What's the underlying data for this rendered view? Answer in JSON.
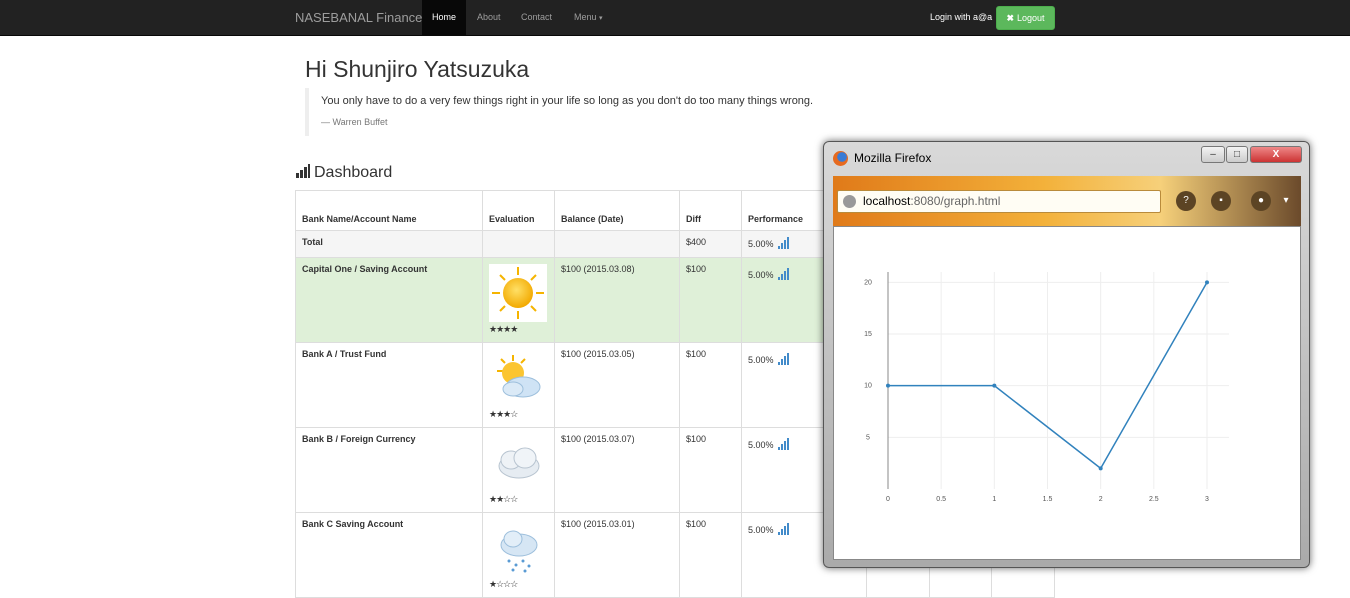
{
  "navbar": {
    "brand": "NASEBANAL Finance",
    "links": [
      {
        "label": "Home",
        "active": true
      },
      {
        "label": "About",
        "active": false
      },
      {
        "label": "Contact",
        "active": false
      },
      {
        "label": "Menu",
        "active": false
      }
    ],
    "menu_caret": "▾",
    "login_text": "Login with a@a",
    "logout_label": "Logout",
    "logout_icon": "✖"
  },
  "greeting": "Hi Shunjiro Yatsuzuka",
  "quote": {
    "text": "You only have to do a very few things right in your life so long as you don't do too many things wrong.",
    "author": "— Warren Buffet"
  },
  "dashboard": {
    "title": "Dashboard",
    "columns": [
      "Bank Name/Account Name",
      "Evaluation",
      "Balance (Date)",
      "Diff",
      "Performance"
    ],
    "total": {
      "name": "Total",
      "diff": "$400",
      "performance": "5.00%"
    },
    "rows": [
      {
        "name": "Capital One / Saving Account",
        "weather": "sunny-icon",
        "rating": 4,
        "stars": "★★★★",
        "balance": "$100 (2015.03.08)",
        "diff": "$100",
        "performance": "5.00%"
      },
      {
        "name": "Bank A / Trust Fund",
        "weather": "partly-cloudy-icon",
        "rating": 3.5,
        "stars": "★★★☆",
        "balance": "$100 (2015.03.05)",
        "diff": "$100",
        "performance": "5.00%"
      },
      {
        "name": "Bank B / Foreign Currency",
        "weather": "cloudy-icon",
        "rating": 2,
        "stars": "★★☆☆",
        "balance": "$100 (2015.03.07)",
        "diff": "$100",
        "performance": "5.00%"
      },
      {
        "name": "Bank C Saving Account",
        "weather": "rain-icon",
        "rating": 1,
        "stars": "★☆☆☆",
        "balance": "$100 (2015.03.01)",
        "diff": "$100",
        "performance": "5.00%"
      }
    ]
  },
  "popup": {
    "window_title": "Mozilla Firefox",
    "url_host": "localhost",
    "url_rest": ":8080/graph.html",
    "controls": {
      "minimize": "–",
      "maximize": "□",
      "close": "X"
    }
  },
  "chart_data": {
    "type": "line",
    "x": [
      0,
      1,
      2,
      3
    ],
    "series": [
      {
        "values": [
          10,
          10,
          2,
          20
        ]
      }
    ],
    "x_ticks": [
      "0",
      "0.5",
      "1",
      "1.5",
      "2",
      "2.5",
      "3"
    ],
    "y_ticks": [
      "5",
      "10",
      "15",
      "20"
    ],
    "xlim": [
      0,
      3
    ],
    "ylim": [
      0,
      21
    ],
    "grid": true,
    "line_color": "#3182bd"
  }
}
